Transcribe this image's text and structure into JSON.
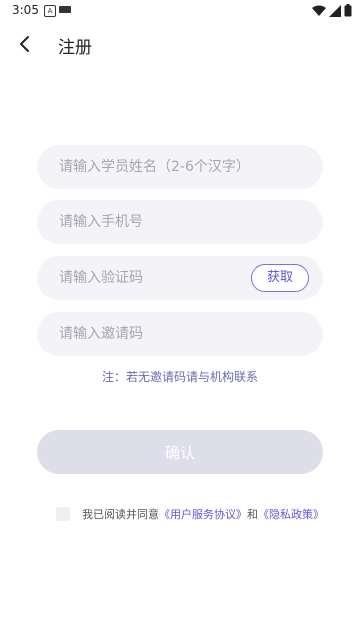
{
  "status_bar": {
    "time": "3:05",
    "a_glyph": "A"
  },
  "header": {
    "title": "注册"
  },
  "form": {
    "name_placeholder": "请输入学员姓名（2-6个汉字）",
    "phone_placeholder": "请输入手机号",
    "code_placeholder": "请输入验证码",
    "get_code_label": "获取",
    "invite_placeholder": "请输入邀请码",
    "note": "注：若无邀请码请与机构联系",
    "confirm_label": "确认"
  },
  "agreement": {
    "prefix": "我已阅读并同意",
    "user_agreement": "《用户服务协议》",
    "conjunction": "和",
    "privacy_policy": "《隐私政策》"
  },
  "colors": {
    "accent": "#6457d8",
    "field_bg": "#f3f3f8",
    "button_disabled": "#dedeea"
  },
  "icons": [
    "back-arrow-icon",
    "wifi-icon",
    "signal-icon",
    "battery-icon"
  ]
}
